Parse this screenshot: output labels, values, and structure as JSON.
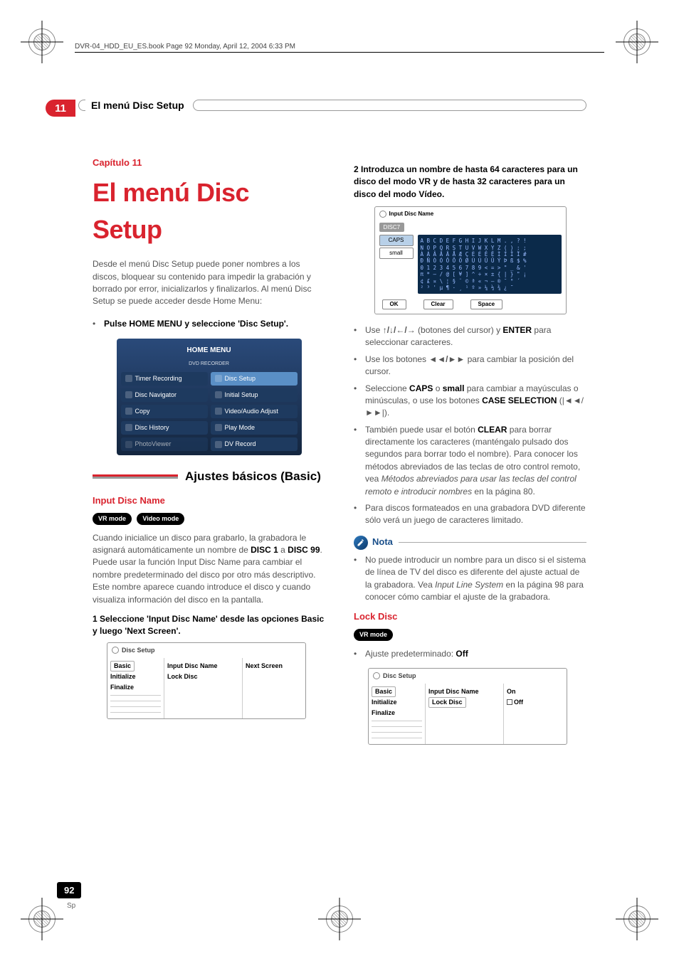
{
  "header": {
    "bookline": "DVR-04_HDD_EU_ES.book  Page 92  Monday, April 12, 2004  6:33 PM"
  },
  "section": {
    "num": "11",
    "title": "El menú Disc Setup"
  },
  "chapter": {
    "label": "Capítulo 11",
    "title": "El menú Disc Setup",
    "intro": "Desde el menú Disc Setup puede poner nombres a los discos, bloquear su contenido para impedir la grabación y borrado por error, inicializarlos y finalizarlos. Al menú Disc Setup se puede acceder desde Home Menu:"
  },
  "step_home": "Pulse HOME MENU y seleccione 'Disc Setup'.",
  "home_menu": {
    "title": "HOME MENU",
    "subtitle": "DVD RECORDER",
    "items": [
      {
        "label": "Timer Recording"
      },
      {
        "label": "Disc Setup"
      },
      {
        "label": "Disc Navigator"
      },
      {
        "label": "Initial Setup"
      },
      {
        "label": "Copy"
      },
      {
        "label": "Video/Audio Adjust"
      },
      {
        "label": "Disc History"
      },
      {
        "label": "Play Mode"
      },
      {
        "label": "PhotoViewer"
      },
      {
        "label": "DV Record"
      }
    ]
  },
  "h2_basic": "Ajustes básicos (Basic)",
  "h3_input": "Input Disc Name",
  "pill_vr": "VR mode",
  "pill_video": "Video mode",
  "input_para": "Cuando inicialice un disco para grabarlo, la grabadora le asignará automáticamente un nombre de ",
  "input_para_b1": "DISC 1",
  "input_para_mid": " a ",
  "input_para_b2": "DISC 99",
  "input_para_2": ". Puede usar la función Input Disc Name para cambiar el nombre predeterminado del disco por otro más descriptivo. Este nombre aparece cuando introduce el disco y cuando visualiza información del disco en la pantalla.",
  "step1": "1   Seleccione 'Input Disc Name' desde las opciones Basic y luego 'Next Screen'.",
  "disc_setup_panel": {
    "title": "Disc Setup",
    "colA": [
      "Basic",
      "Initialize",
      "Finalize"
    ],
    "colB": [
      "Input Disc Name",
      "Lock Disc"
    ],
    "colC": [
      "Next Screen"
    ]
  },
  "step2": "2   Introduzca un nombre de hasta 64 caracteres para un disco del modo VR y de hasta 32 caracteres para un disco del modo Vídeo.",
  "input_panel": {
    "title": "Input Disc Name",
    "disc": "DISC7",
    "left": [
      "CAPS",
      "small"
    ],
    "chars": "A B C D E F G H I J K L M . , ? !\nN O P Q R S T U V W X Y Z ( ) : ;\nÀ Á Â Ã Ä Å Æ Ç È É Ê Ë Ì Í Î Ï #\nÐ Ñ Ò Ó Ô Õ Ö Ø Ù Ú Û Ü Ý Þ ß $ %\n0 1 2 3 4 5 6 7 8 9 < = > \" _ & '\nπ * – / @ [ ¥ ] ^ ÷ × ± { | } \" ¡\n¢ £ ¤ \\ ¦ § ¨ © ª « ¬ – ® ¯ ° ´\n² ³ ' µ ¶ · ¸ ¹ º » ¼ ½ ¾ ¿ ˜",
    "footer": [
      "OK",
      "Clear",
      "Space"
    ]
  },
  "right_bullets": [
    {
      "pre": "Use ",
      "sym": "↑/↓/←/→",
      "mid": " (botones del cursor) y ",
      "b": "ENTER",
      "post": " para seleccionar caracteres."
    },
    {
      "pre": "Use los botones ",
      "sym": "◄◄/►►",
      "post": " para cambiar la posición del cursor."
    },
    {
      "pre": "Seleccione ",
      "b": "CAPS",
      "mid": " o ",
      "b2": "small",
      "post": " para cambiar a mayúsculas o minúsculas, o use los botones ",
      "b3": "CASE SELECTION",
      "post2": " (|◄◄/►►|)."
    },
    {
      "pre": "También puede usar el botón ",
      "b": "CLEAR",
      "post": " para borrar directamente los caracteres (manténgalo pulsado dos segundos para borrar todo el nombre). Para conocer los métodos abreviados de las teclas de otro control remoto, vea ",
      "it": "Métodos abreviados para usar las teclas del control remoto e introducir nombres",
      "post2": " en la página 80."
    },
    {
      "pre": "Para discos formateados en una grabadora DVD diferente sólo verá un juego de caracteres limitado."
    }
  ],
  "note_label": "Nota",
  "note_body_pre": "No puede introducir un nombre para un disco si el sistema de línea de TV del disco es diferente del ajuste actual de la grabadora. Vea ",
  "note_body_it": "Input Line System",
  "note_body_post": " en la página 98 para conocer cómo cambiar el ajuste de la grabadora.",
  "h3_lock": "Lock Disc",
  "lock_pre": "Ajuste predeterminado: ",
  "lock_val": "Off",
  "lock_panel": {
    "title": "Disc Setup",
    "colA": [
      "Basic",
      "Initialize",
      "Finalize"
    ],
    "colB": [
      "Input Disc Name",
      "Lock Disc"
    ],
    "colC": [
      "On",
      "Off"
    ]
  },
  "page": {
    "num": "92",
    "lang": "Sp"
  }
}
